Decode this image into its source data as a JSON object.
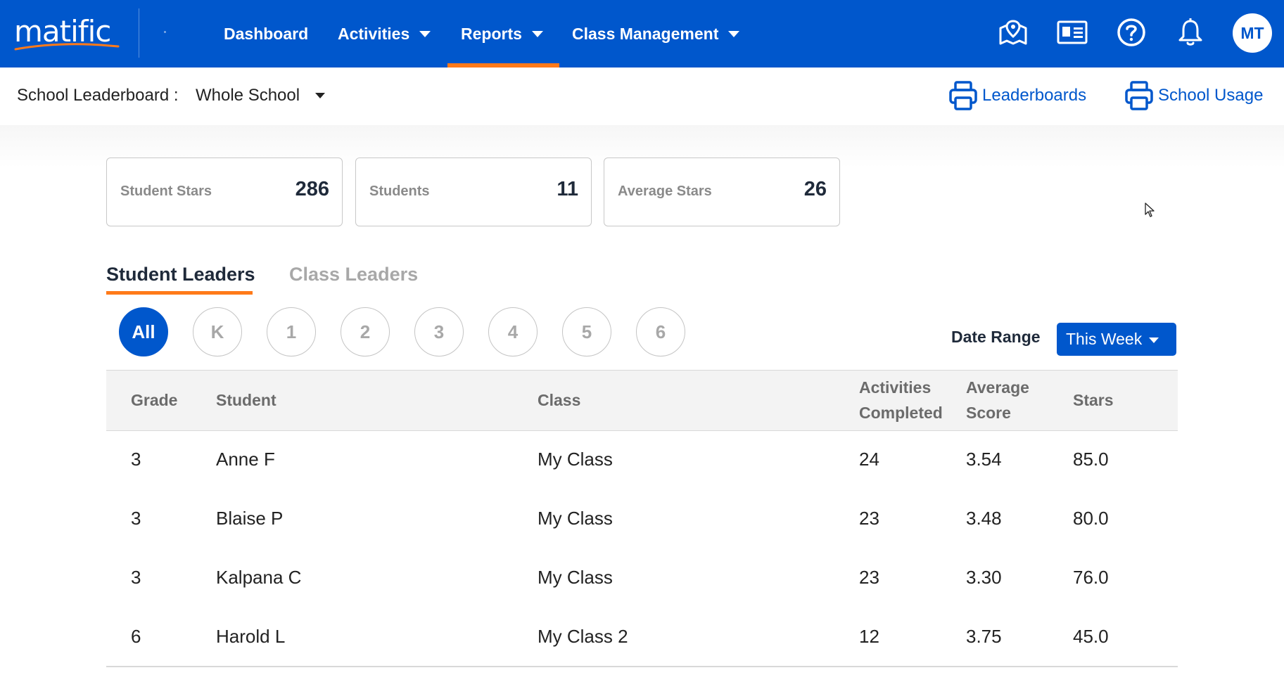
{
  "brand": {
    "logo_text": "matific"
  },
  "nav": {
    "items": [
      {
        "label": "Dashboard",
        "has_caret": false
      },
      {
        "label": "Activities",
        "has_caret": true
      },
      {
        "label": "Reports",
        "has_caret": true,
        "active": true
      },
      {
        "label": "Class Management",
        "has_caret": true
      }
    ],
    "icons": [
      "map-pin-icon",
      "id-card-icon",
      "help-icon",
      "bell-icon"
    ],
    "avatar_initials": "MT",
    "accent_color": "#0057cc",
    "active_indicator_color": "#ff7a1a"
  },
  "subheader": {
    "label": "School Leaderboard :",
    "scope_value": "Whole School",
    "print_links": [
      {
        "label": "Leaderboards",
        "icon": "printer-icon"
      },
      {
        "label": "School Usage",
        "icon": "printer-icon"
      }
    ]
  },
  "stats": [
    {
      "label": "Student Stars",
      "value": "286"
    },
    {
      "label": "Students",
      "value": "11"
    },
    {
      "label": "Average Stars",
      "value": "26"
    }
  ],
  "tabs": [
    {
      "label": "Student Leaders",
      "active": true
    },
    {
      "label": "Class Leaders",
      "active": false
    }
  ],
  "grade_filters": [
    {
      "label": "All",
      "active": true
    },
    {
      "label": "K",
      "active": false
    },
    {
      "label": "1",
      "active": false
    },
    {
      "label": "2",
      "active": false
    },
    {
      "label": "3",
      "active": false
    },
    {
      "label": "4",
      "active": false
    },
    {
      "label": "5",
      "active": false
    },
    {
      "label": "6",
      "active": false
    }
  ],
  "date_range": {
    "label": "Date Range",
    "value": "This Week"
  },
  "table": {
    "headers": {
      "grade": "Grade",
      "student": "Student",
      "class": "Class",
      "activities_line1": "Activities",
      "activities_line2": "Completed",
      "avg_line1": "Average",
      "avg_line2": "Score",
      "stars": "Stars"
    },
    "rows": [
      {
        "grade": "3",
        "student": "Anne F",
        "class": "My Class",
        "activities": "24",
        "avg": "3.54",
        "stars": "85.0"
      },
      {
        "grade": "3",
        "student": "Blaise P",
        "class": "My Class",
        "activities": "23",
        "avg": "3.48",
        "stars": "80.0"
      },
      {
        "grade": "3",
        "student": "Kalpana C",
        "class": "My Class",
        "activities": "23",
        "avg": "3.30",
        "stars": "76.0"
      },
      {
        "grade": "6",
        "student": "Harold L",
        "class": "My Class 2",
        "activities": "12",
        "avg": "3.75",
        "stars": "45.0"
      }
    ]
  }
}
